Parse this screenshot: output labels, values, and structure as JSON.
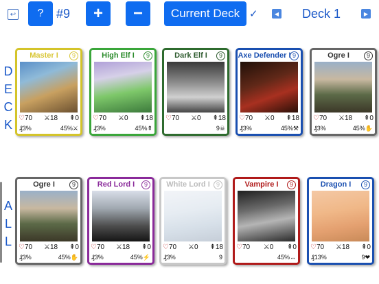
{
  "toolbar": {
    "back_icon": "undo-arrow-icon",
    "help_label": "?",
    "deck_number": "#9",
    "add_label": "+",
    "remove_label": "−",
    "deck_toggle_label": "Current Deck",
    "check_mark": "✓",
    "prev_icon": "◀",
    "deck_name": "Deck 1",
    "next_icon": "▶"
  },
  "sections": {
    "deck_letters": [
      "D",
      "E",
      "C",
      "K"
    ],
    "all_letters": [
      "A",
      "L",
      "L"
    ]
  },
  "deck_cards": [
    {
      "name": "Master I",
      "level": "9",
      "hp": "70",
      "atk": "18",
      "def": "0",
      "cost": "3%",
      "bonus": "45%⚔",
      "color": "#d4c42a",
      "name_color": "#d8c634"
    },
    {
      "name": "High Elf I",
      "level": "9",
      "hp": "70",
      "atk": "0",
      "def": "18",
      "cost": "3%",
      "bonus": "45%⇞",
      "color": "#3aa63a",
      "name_color": "#2a8a2a"
    },
    {
      "name": "Dark Elf I",
      "level": "9",
      "hp": "70",
      "atk": "0",
      "def": "18",
      "cost": "",
      "bonus": "9☠",
      "color": "#2e6b2e",
      "name_color": "#2d5a2d"
    },
    {
      "name": "Axe Defender I",
      "level": "9",
      "hp": "70",
      "atk": "0",
      "def": "18",
      "cost": "3%",
      "bonus": "45%⚒",
      "color": "#1a4fb0",
      "name_color": "#1a4fb0"
    },
    {
      "name": "Ogre I",
      "level": "9",
      "hp": "70",
      "atk": "18",
      "def": "0",
      "cost": "3%",
      "bonus": "45%✋",
      "color": "#666666",
      "name_color": "#333333"
    }
  ],
  "all_cards": [
    {
      "name": "Ogre I",
      "level": "9",
      "hp": "70",
      "atk": "18",
      "def": "0",
      "cost": "3%",
      "bonus": "45%✋",
      "color": "#666666",
      "name_color": "#333333"
    },
    {
      "name": "Red Lord I",
      "level": "9",
      "hp": "70",
      "atk": "18",
      "def": "0",
      "cost": "3%",
      "bonus": "45%⚡",
      "color": "#8a2a9a",
      "name_color": "#8a2a9a"
    },
    {
      "name": "White Lord I",
      "level": "9",
      "hp": "70",
      "atk": "0",
      "def": "18",
      "cost": "3%",
      "bonus": "9",
      "color": "#c8c8c8",
      "name_color": "#bdbdbd"
    },
    {
      "name": "Vampire I",
      "level": "9",
      "hp": "70",
      "atk": "0",
      "def": "0",
      "cost": "",
      "bonus": "45%↔",
      "color": "#b01a1a",
      "name_color": "#b01a1a"
    },
    {
      "name": "Dragon I",
      "level": "9",
      "hp": "70",
      "atk": "18",
      "def": "0",
      "cost": "13%",
      "bonus": "9❤",
      "color": "#1a4fb0",
      "name_color": "#1a4fb0"
    }
  ]
}
